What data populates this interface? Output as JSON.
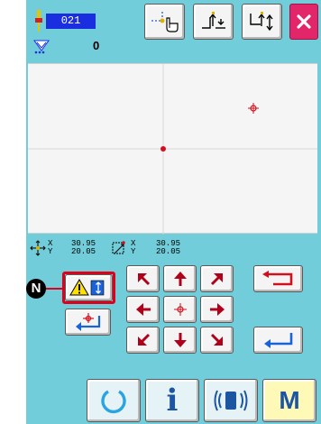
{
  "header": {
    "needle_number": "021",
    "stitch_count_value": "0"
  },
  "coords": {
    "pos_x": "30.95",
    "pos_y": "20.05",
    "size_x": "30.95",
    "size_y": "20.05",
    "x_label": "X",
    "y_label": "Y"
  },
  "callout": {
    "label": "N"
  },
  "icons": {
    "toolbar": [
      "point-select-icon",
      "feed-forward-icon",
      "feed-back-icon",
      "close-icon"
    ],
    "jog": [
      "arrow-up-left-icon",
      "arrow-up-icon",
      "arrow-up-right-icon",
      "arrow-left-icon",
      "origin-crosshair-icon",
      "arrow-right-icon",
      "arrow-down-left-icon",
      "arrow-down-icon",
      "arrow-down-right-icon"
    ],
    "bottom_bar": [
      "reset-icon",
      "info-icon",
      "communication-icon",
      "mode-icon"
    ]
  },
  "bottom_bar": {
    "mode_label": "M",
    "info_label": "i"
  },
  "colors": {
    "accent": "#70cdd9",
    "bar": "#1c56a3",
    "jog_arrow": "#b0001a",
    "enter_blue": "#1a62d8",
    "callout": "#e0001b"
  }
}
